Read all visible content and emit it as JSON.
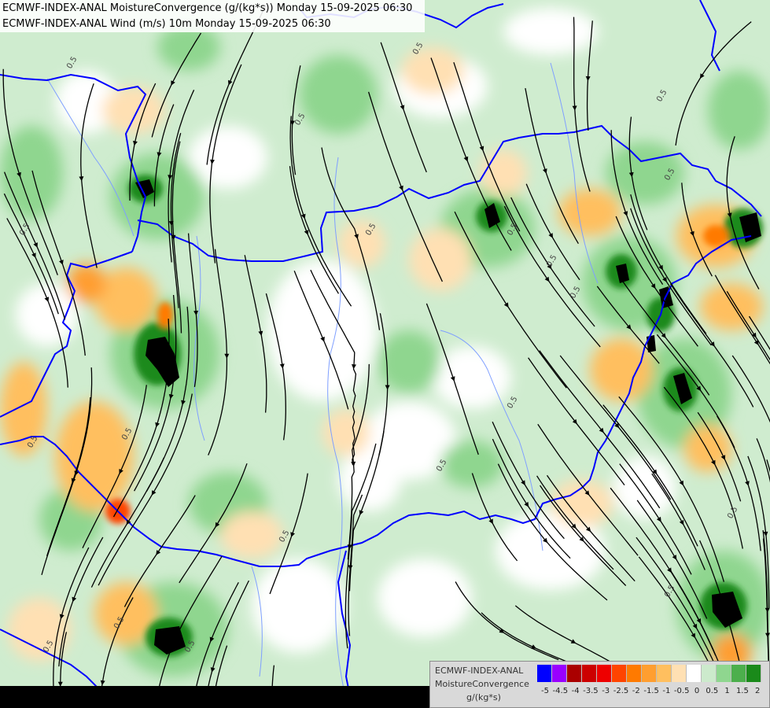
{
  "header": {
    "line1": "ECMWF-INDEX-ANAL MoistureConvergence (g/(kg*s)) Monday 15-09-2025 06:30",
    "line2": "ECMWF-INDEX-ANAL Wind (m/s) 10m Monday 15-09-2025 06:30"
  },
  "legend": {
    "source": "ECMWF-INDEX-ANAL",
    "variable": "MoistureConvergence",
    "unit": "g/(kg*s)",
    "ticks": [
      "-5",
      "-4.5",
      "-4",
      "-3.5",
      "-3",
      "-2.5",
      "-2",
      "-1.5",
      "-1",
      "-0.5",
      "0",
      "0.5",
      "1",
      "1.5",
      "2"
    ],
    "colors": [
      "#0000ff",
      "#9900ff",
      "#aa0000",
      "#cc0000",
      "#ee0000",
      "#ff4400",
      "#ff7a00",
      "#ff9e30",
      "#ffbf5f",
      "#ffe0b3",
      "#ffffff",
      "#cceacc",
      "#8fd68f",
      "#4caf4c",
      "#1a8a1a"
    ]
  },
  "map": {
    "contour_label": "0.5",
    "colors": {
      "border": "#0000ff",
      "river": "#7f9fff",
      "streamline": "#000000",
      "dark_blob": "#000000"
    }
  }
}
